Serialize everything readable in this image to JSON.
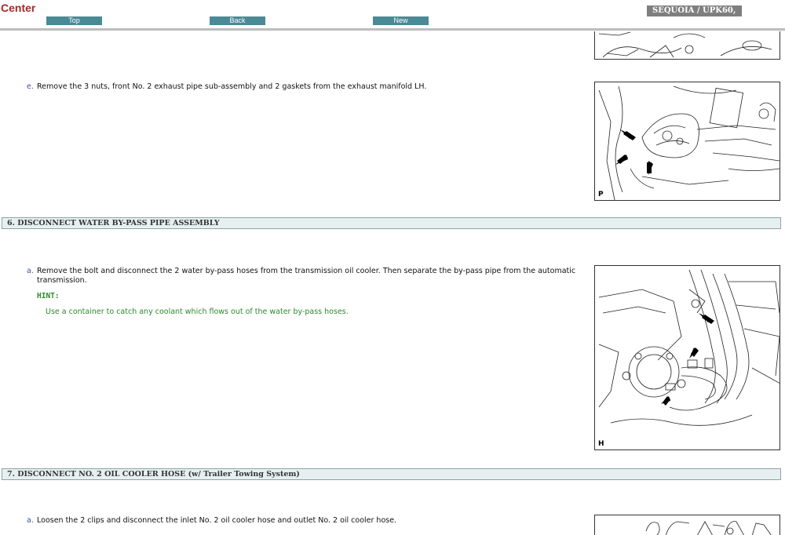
{
  "header": {
    "brand": "Center",
    "nav": {
      "top": "Top",
      "back": "Back",
      "new": "New"
    },
    "model": "SEQUOIA / UPK60,"
  },
  "steps": {
    "e": {
      "letter": "e.",
      "text": "Remove the 3 nuts, front No. 2 exhaust pipe sub-assembly and 2 gaskets from the exhaust manifold LH.",
      "figure_code": "P"
    },
    "s6": {
      "title": "6. DISCONNECT WATER BY-PASS PIPE ASSEMBLY",
      "a": {
        "letter": "a.",
        "text_line1": "Remove the bolt and disconnect the 2 water by-pass hoses from the transmission oil cooler. Then separate the by-pass pipe from the automatic",
        "text_line2": "transmission.",
        "hint_label": "HINT:",
        "hint_text": "Use a container to catch any coolant which flows out of the water by-pass hoses.",
        "figure_code": "H"
      }
    },
    "s7": {
      "title": "7. DISCONNECT NO. 2 OIL COOLER HOSE (w/ Trailer Towing System)",
      "a": {
        "letter": "a.",
        "text": "Loosen the 2 clips and disconnect the inlet No. 2 oil cooler hose and outlet No. 2 oil cooler hose."
      }
    }
  }
}
